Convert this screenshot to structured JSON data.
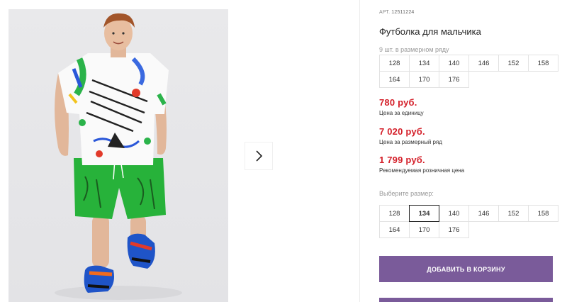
{
  "product": {
    "sku_label": "АРТ.",
    "sku": "12511224",
    "title": "Футболка для мальчика",
    "image_alt": "product-photo"
  },
  "size_row": {
    "label": "9 шт. в размерном ряду",
    "sizes": [
      "128",
      "134",
      "140",
      "146",
      "152",
      "158",
      "164",
      "170",
      "176"
    ]
  },
  "prices": [
    {
      "value": "780 руб.",
      "note": "Цена за единицу"
    },
    {
      "value": "7 020 руб.",
      "note": "Цена за размерный ряд"
    },
    {
      "value": "1 799 руб.",
      "note": "Рекомендуемая розничная цена"
    }
  ],
  "size_picker": {
    "label": "Выберите размер:",
    "sizes": [
      "128",
      "134",
      "140",
      "146",
      "152",
      "158",
      "164",
      "170",
      "176"
    ],
    "selected": "134"
  },
  "actions": {
    "add_to_cart": "ДОБАВИТЬ В КОРЗИНУ"
  },
  "colors": {
    "price": "#d4202a",
    "button": "#7a5b9a",
    "shorts": "#27b23a"
  },
  "icons": {
    "next": "chevron-right-icon"
  }
}
